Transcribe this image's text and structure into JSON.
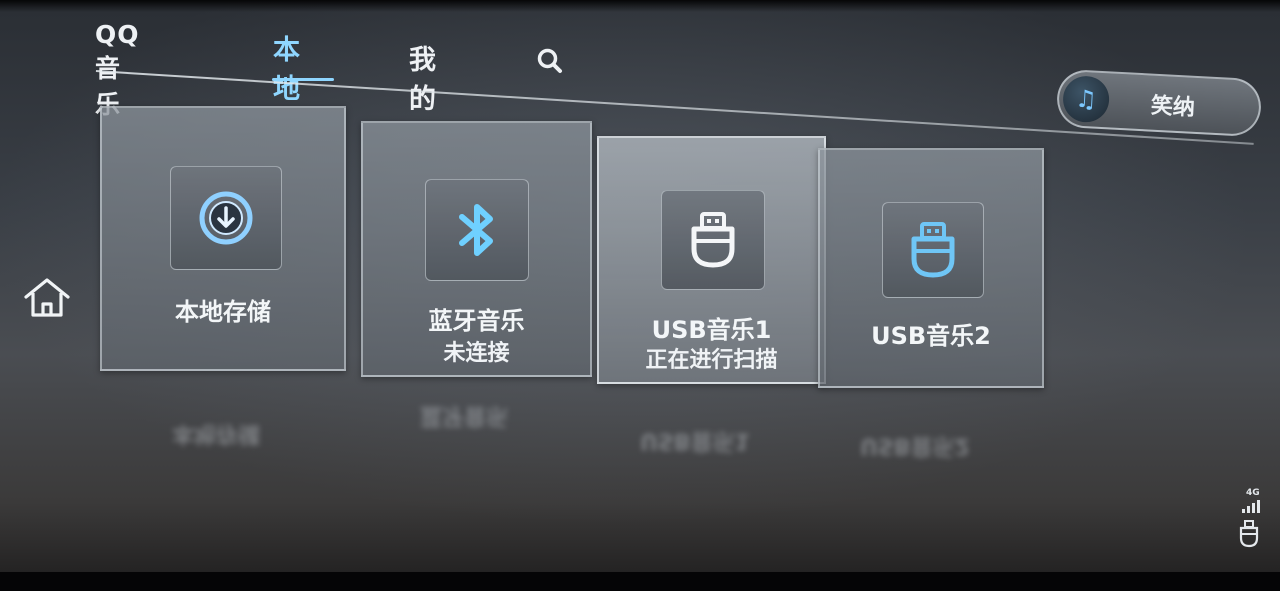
{
  "header": {
    "tabs": [
      {
        "label": "QQ音乐"
      },
      {
        "label": "本地"
      },
      {
        "label": "我的"
      }
    ],
    "search_icon": "search-icon"
  },
  "pill": {
    "icon": "music-note-icon",
    "label": "笑纳"
  },
  "home_icon": "home-icon",
  "sources": [
    {
      "title": "本地存储",
      "icon": "download-circle-icon"
    },
    {
      "title": "蓝牙音乐",
      "subtitle": "未连接",
      "icon": "bluetooth-icon"
    },
    {
      "title": "USB音乐1",
      "subtitle": "正在进行扫描",
      "icon": "usb-drive-icon"
    },
    {
      "title": "USB音乐2",
      "icon": "usb-drive-icon"
    }
  ],
  "status_bar": {
    "network": "4G",
    "icons": [
      "signal-icon",
      "usb-icon"
    ]
  },
  "colors": {
    "accent": "#8fd6ff",
    "icon_blue": "#5fb8f0"
  }
}
